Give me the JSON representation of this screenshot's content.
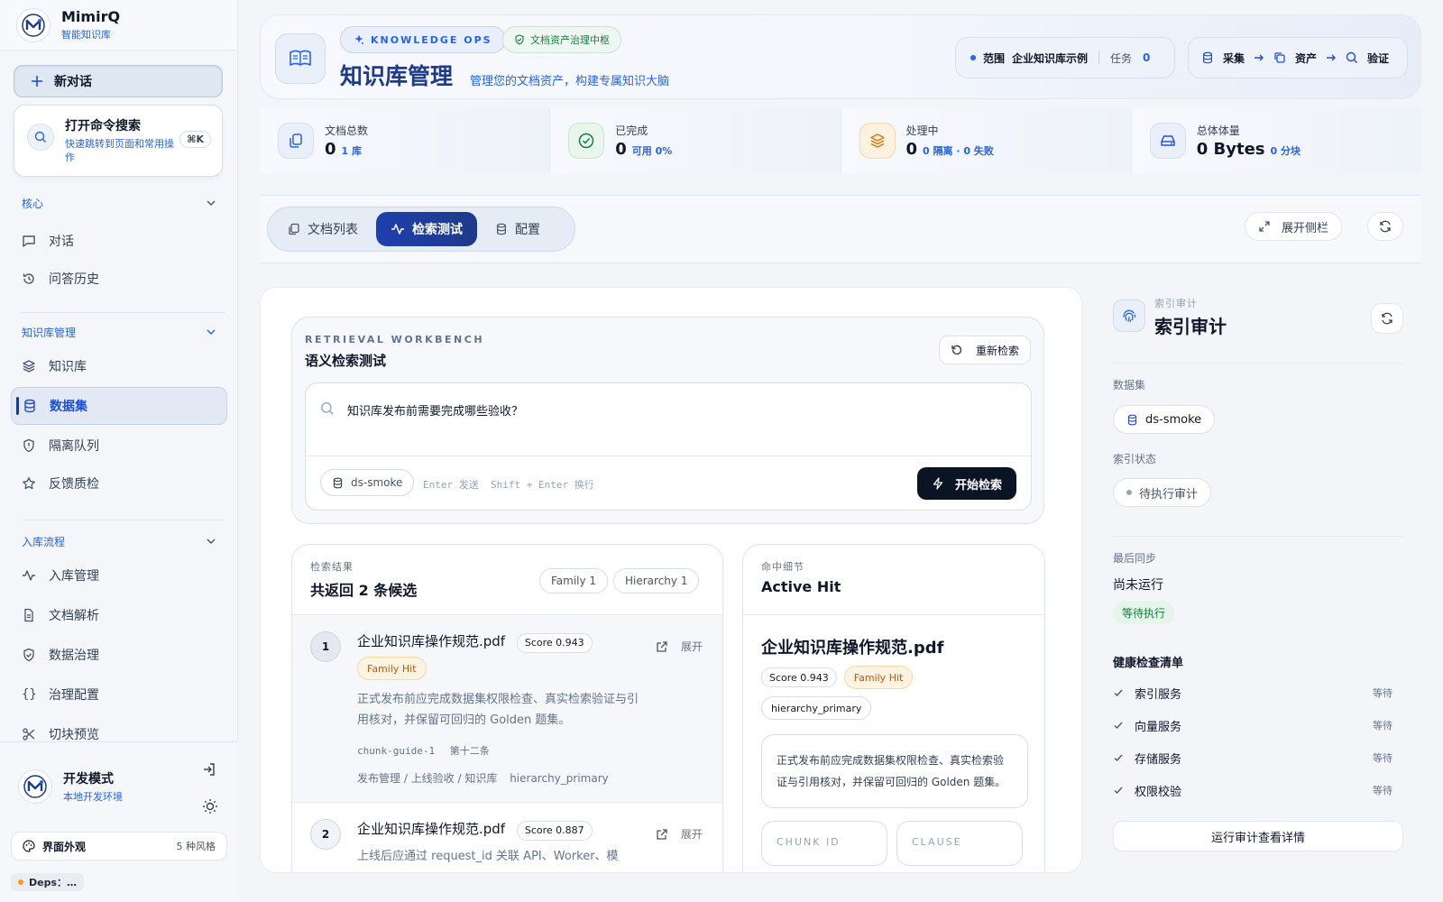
{
  "brand": {
    "name": "MimirQ",
    "subtitle": "智能知识库"
  },
  "sidebar": {
    "new_chat": "新对话",
    "command": {
      "title": "打开命令搜索",
      "desc": "快速跳转到页面和常用操作",
      "shortcut": "⌘K"
    },
    "sections": [
      {
        "title": "核心",
        "items": [
          {
            "label": "对话"
          },
          {
            "label": "问答历史"
          }
        ]
      },
      {
        "title": "知识库管理",
        "items": [
          {
            "label": "知识库"
          },
          {
            "label": "数据集"
          },
          {
            "label": "隔离队列"
          },
          {
            "label": "反馈质检"
          }
        ]
      },
      {
        "title": "入库流程",
        "items": [
          {
            "label": "入库管理"
          },
          {
            "label": "文档解析"
          },
          {
            "label": "数据治理"
          },
          {
            "label": "治理配置"
          },
          {
            "label": "切块预览"
          }
        ]
      }
    ],
    "dev": {
      "title": "开发模式",
      "subtitle": "本地开发环境"
    },
    "appearance": {
      "label": "界面外观",
      "count": "5 种风格"
    },
    "deps": "Deps：…"
  },
  "header": {
    "chip_ops": "KNOWLEDGE OPS",
    "chip_gov": "文档资产治理中枢",
    "title": "知识库管理",
    "subtitle": "管理您的文档资产，构建专属知识大脑",
    "scope_label": "范围",
    "scope_value": "企业知识库示例",
    "task_label": "任务",
    "task_value": "0",
    "pipeline": [
      "采集",
      "资产",
      "验证"
    ]
  },
  "stats": [
    {
      "label": "文档总数",
      "value": "0",
      "extra": "1 库"
    },
    {
      "label": "已完成",
      "value": "0",
      "extra": "可用 0%"
    },
    {
      "label": "处理中",
      "value": "0",
      "extra": "0 隔离 · 0 失败"
    },
    {
      "label": "总体体量",
      "value": "0 Bytes",
      "extra": "0 分块"
    }
  ],
  "tabs": [
    {
      "label": "文档列表"
    },
    {
      "label": "检索测试"
    },
    {
      "label": "配置"
    }
  ],
  "toolbar": {
    "expand": "展开侧栏"
  },
  "workbench": {
    "eyebrow": "RETRIEVAL WORKBENCH",
    "title": "语义检索测试",
    "rerun": "重新检索",
    "query": "知识库发布前需要完成哪些验收？",
    "dataset": "ds-smoke",
    "hint": "Enter 发送  Shift + Enter 换行",
    "go": "开始检索"
  },
  "results": {
    "eyebrow": "检索结果",
    "title": "共返回 2 条候选",
    "tags": [
      "Family 1",
      "Hierarchy 1"
    ],
    "items": [
      {
        "num": "1",
        "file": "企业知识库操作规范.pdf",
        "score": "Score 0.943",
        "badge": "Family Hit",
        "action": "展开",
        "snippet": "正式发布前应完成数据集权限检查、真实检索验证与引用核对，并保留可回归的 Golden 题集。",
        "chunk": "chunk-guide-1",
        "clause": "第十二条",
        "path": "发布管理 / 上线验收 / 知识库",
        "level": "hierarchy_primary"
      },
      {
        "num": "2",
        "file": "企业知识库操作规范.pdf",
        "score": "Score 0.887",
        "action": "展开",
        "snippet": "上线后应通过 request_id 关联 API、Worker、模"
      }
    ]
  },
  "detail": {
    "eyebrow": "命中细节",
    "title": "Active Hit",
    "file": "企业知识库操作规范.pdf",
    "score": "Score 0.943",
    "badge": "Family Hit",
    "level": "hierarchy_primary",
    "text": "正式发布前应完成数据集权限检查、真实检索验证与引用核对，并保留可回归的 Golden 题集。",
    "chunk_label": "CHUNK ID",
    "clause_label": "CLAUSE"
  },
  "audit": {
    "eyebrow": "索引审计",
    "title": "索引审计",
    "dataset_label": "数据集",
    "dataset": "ds-smoke",
    "status_label": "索引状态",
    "status": "待执行审计",
    "sync_label": "最后同步",
    "sync_value": "尚未运行",
    "sync_badge": "等待执行",
    "checklist_title": "健康检查清单",
    "checks": [
      {
        "label": "索引服务",
        "state": "等待"
      },
      {
        "label": "向量服务",
        "state": "等待"
      },
      {
        "label": "存储服务",
        "state": "等待"
      },
      {
        "label": "权限校验",
        "state": "等待"
      }
    ],
    "run": "运行审计查看详情"
  },
  "colors": {
    "accent": "#2563eb",
    "nav_active": "#1e3a8a",
    "primary_btn": "#0b1424",
    "warn": "#c2570c",
    "success": "#15803d"
  }
}
